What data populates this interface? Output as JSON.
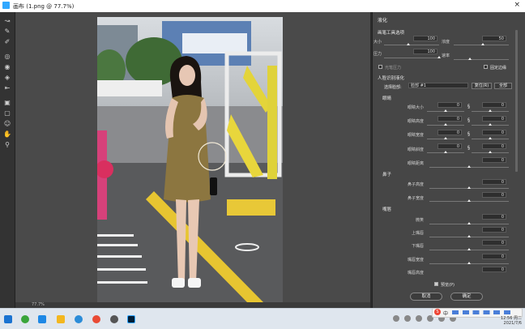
{
  "window": {
    "title": "画布 (1.png @ 77.7%)",
    "close_glyph": "×"
  },
  "tools": [
    "move-tool",
    "brush-tool",
    "smudge-tool",
    "blur-tool",
    "clone-tool",
    "bloat-tool",
    "pucker-tool",
    "push-left-tool",
    "freeze-mask-tool",
    "thaw-mask-tool",
    "face-tool",
    "hand-tool",
    "zoom-tool"
  ],
  "status": {
    "zoom": "77.7%"
  },
  "panel": {
    "title": "液化",
    "brush_section": "画笔工具选项",
    "size_label": "大小",
    "size_value": "100",
    "density_label": "浓度",
    "density_value": "50",
    "pressure_label": "压力",
    "pressure_value": "100",
    "rate_label": "速率",
    "rate_value": "0",
    "stylus_label": "光笔压力",
    "pin_label": "固定边缘",
    "face_section": "人脸识别液化",
    "select_face_label": "选择脸部:",
    "select_face_value": "脸部 #1",
    "reset_label": "复位(R)",
    "all_label": "全部",
    "eyes_section": "眼睛",
    "eye_size_label": "眼睛大小",
    "eye_size_l": "0",
    "eye_size_r": "0",
    "eye_height_label": "眼睛高度",
    "eye_height_l": "0",
    "eye_height_r": "0",
    "eye_width_label": "眼睛宽度",
    "eye_width_l": "0",
    "eye_width_r": "0",
    "eye_tilt_label": "眼睛斜度",
    "eye_tilt_l": "0",
    "eye_tilt_r": "0",
    "eye_dist_label": "眼睛距离",
    "eye_dist": "0",
    "nose_section": "鼻子",
    "nose_height_label": "鼻子高度",
    "nose_height": "0",
    "nose_width_label": "鼻子宽度",
    "nose_width": "0",
    "mouth_section": "嘴唇",
    "smile_label": "微笑",
    "smile": "0",
    "upper_lip_label": "上嘴唇",
    "upper_lip": "0",
    "lower_lip_label": "下嘴唇",
    "lower_lip": "0",
    "mouth_width_label": "嘴唇宽度",
    "mouth_width": "0",
    "mouth_height_label": "嘴唇高度",
    "mouth_height": "0",
    "preview_label": "预览(P)",
    "cancel_label": "取消",
    "ok_label": "确定"
  },
  "ime": {
    "text": "中"
  },
  "clock": {
    "time": "12:56 周二",
    "date": "2021/7/6"
  }
}
